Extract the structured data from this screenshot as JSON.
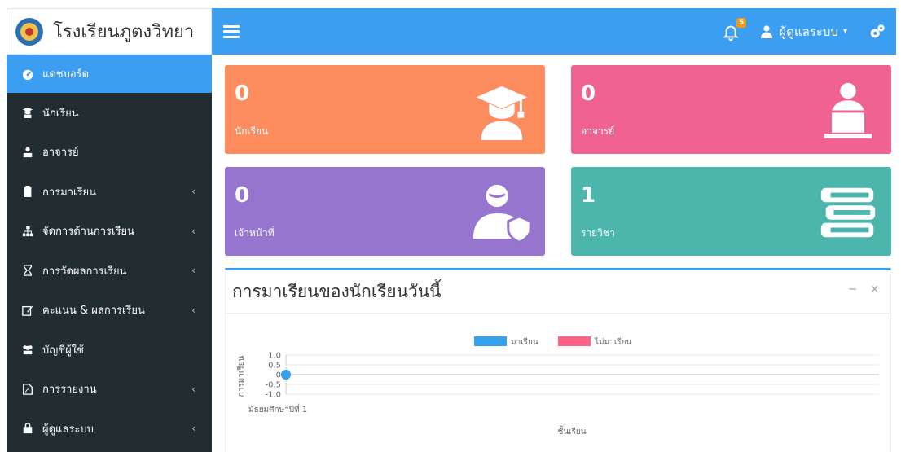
{
  "brand": {
    "name": "โรงเรียนภูตงวิทยา"
  },
  "navbar": {
    "notification_count": "5",
    "user_label": "ผู้ดูแลระบบ"
  },
  "sidebar": {
    "items": [
      {
        "label": "แดชบอร์ด",
        "icon": "dashboard-icon",
        "active": true,
        "expandable": false
      },
      {
        "label": "นักเรียน",
        "icon": "student-icon",
        "active": false,
        "expandable": false
      },
      {
        "label": "อาจารย์",
        "icon": "teacher-icon",
        "active": false,
        "expandable": false
      },
      {
        "label": "การมาเรียน",
        "icon": "clipboard-icon",
        "active": false,
        "expandable": true
      },
      {
        "label": "จัดการด้านการเรียน",
        "icon": "sitemap-icon",
        "active": false,
        "expandable": true
      },
      {
        "label": "การวัดผลการเรียน",
        "icon": "hourglass-icon",
        "active": false,
        "expandable": true
      },
      {
        "label": "คะแนน & ผลการเรียน",
        "icon": "edit-icon",
        "active": false,
        "expandable": true
      },
      {
        "label": "บัญชีผู้ใช้",
        "icon": "users-icon",
        "active": false,
        "expandable": false
      },
      {
        "label": "การรายงาน",
        "icon": "pdf-file-icon",
        "active": false,
        "expandable": true
      },
      {
        "label": "ผู้ดูแลระบบ",
        "icon": "database-icon",
        "active": false,
        "expandable": true
      }
    ]
  },
  "stats": [
    {
      "value": "0",
      "label": "นักเรียน",
      "color": "#fd8c5f",
      "icon": "graduate-icon"
    },
    {
      "value": "0",
      "label": "อาจารย์",
      "color": "#f06292",
      "icon": "teacher-laptop-icon"
    },
    {
      "value": "0",
      "label": "เจ้าหน้าที่",
      "color": "#9575cd",
      "icon": "user-shield-icon"
    },
    {
      "value": "1",
      "label": "รายวิชา",
      "color": "#4db6ac",
      "icon": "books-icon"
    }
  ],
  "panel": {
    "title": "การมาเรียนของนักเรียนวันนี้",
    "tools": [
      "−",
      "×"
    ]
  },
  "chart_data": {
    "type": "bar",
    "categories": [
      "มัธยมศึกษาปีที่ 1"
    ],
    "series": [
      {
        "name": "มาเรียน",
        "color": "#36a2eb",
        "values": [
          0
        ]
      },
      {
        "name": "ไม่มาเรียน",
        "color": "#ff6384",
        "values": [
          0
        ]
      }
    ],
    "xlabel": "ชั้นเรียน",
    "ylabel": "การมาเรียน",
    "ylim": [
      -1.0,
      1.0
    ],
    "yticks": [
      "1.0",
      "0.5",
      "0",
      "-0.5",
      "-1.0"
    ],
    "legend": "top",
    "grid": true
  }
}
